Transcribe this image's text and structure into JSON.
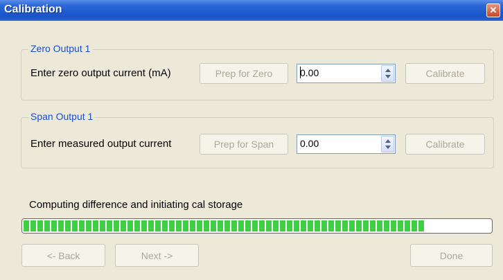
{
  "window": {
    "title": "Calibration"
  },
  "zero_group": {
    "legend": "Zero Output 1",
    "label": "Enter zero output current (mA)",
    "prep_button": "Prep for Zero",
    "value": "0.00",
    "calibrate_button": "Calibrate"
  },
  "span_group": {
    "legend": "Span Output 1",
    "label": "Enter measured output current",
    "prep_button": "Prep for Span",
    "value": "0.00",
    "calibrate_button": "Calibrate"
  },
  "status": {
    "text": "Computing difference and initiating cal storage",
    "progress_fraction": 0.86
  },
  "nav": {
    "back_button": "<- Back",
    "next_button": "Next ->",
    "done_button": "Done"
  },
  "colors": {
    "progress_green": "#3fcf45",
    "title_blue": "#1f5cd0",
    "legend_blue": "#1a4fd6"
  },
  "icons": {
    "close": "close-icon"
  }
}
